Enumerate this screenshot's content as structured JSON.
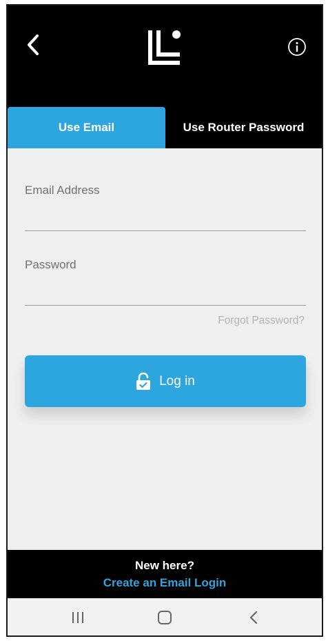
{
  "header": {
    "back_icon": "chevron-left-icon",
    "logo_icon": "linksys-logo",
    "info_icon": "info-circle-icon"
  },
  "tabs": [
    {
      "label": "Use Email",
      "active": true
    },
    {
      "label": "Use Router Password",
      "active": false
    }
  ],
  "form": {
    "email": {
      "label": "Email Address",
      "value": ""
    },
    "password": {
      "label": "Password",
      "value": ""
    },
    "forgot_label": "Forgot Password?"
  },
  "login_button": {
    "label": "Log in",
    "icon": "lock-icon"
  },
  "footer": {
    "prompt": "New here?",
    "link": "Create an Email Login"
  },
  "system_nav": {
    "recents_icon": "recents-icon",
    "home_icon": "home-icon",
    "back_icon": "back-icon"
  },
  "colors": {
    "accent": "#2da5df",
    "header_bg": "#000000",
    "content_bg": "#efefef",
    "muted_text": "#b3b3b3"
  }
}
